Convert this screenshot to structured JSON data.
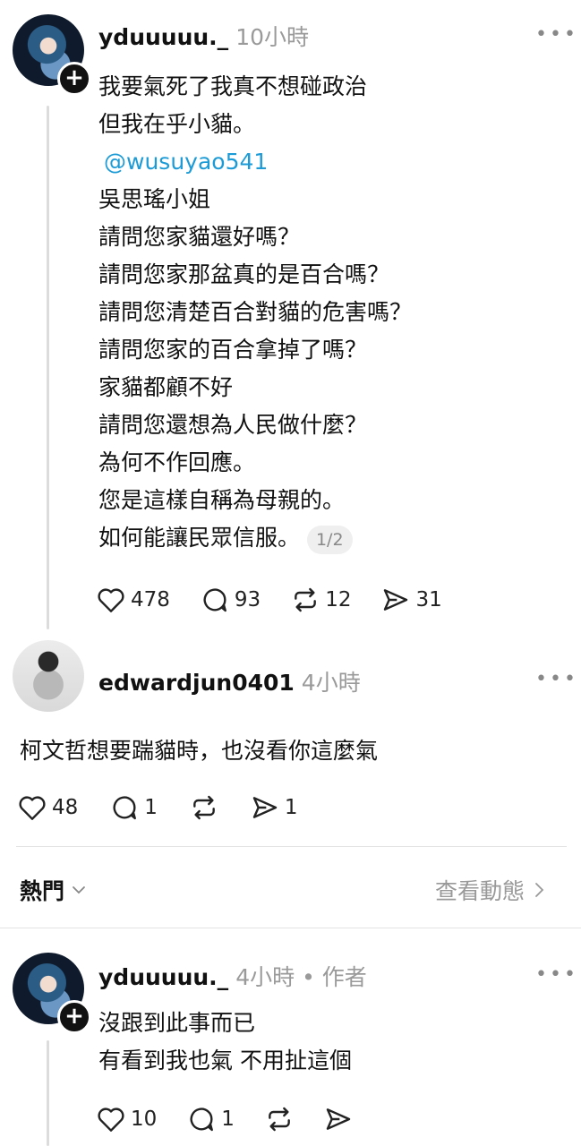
{
  "post": {
    "username": "yduuuuu._",
    "time": "10小時",
    "lines": [
      "我要氣死了我真不想碰政治",
      "但我在乎小貓。",
      "@wusuyao541",
      "吳思瑤小姐",
      "請問您家貓還好嗎？",
      "請問您家那盆真的是百合嗎？",
      "請問您清楚百合對貓的危害嗎？",
      "請問您家的百合拿掉了嗎？",
      "家貓都顧不好",
      "請問您還想為人民做什麼？",
      "為何不作回應。",
      "您是這樣自稱為母親的。",
      "如何能讓民眾信服。"
    ],
    "pager": "1/2",
    "likes": "478",
    "comments": "93",
    "reposts": "12",
    "shares": "31"
  },
  "reply1": {
    "username": "edwardjun0401",
    "time": "4小時",
    "text": "柯文哲想要踹貓時，也沒看你這麼氣",
    "likes": "48",
    "comments": "1",
    "shares": "1"
  },
  "section": {
    "hot_label": "熱門",
    "view_all": "查看動態"
  },
  "reply2": {
    "username": "yduuuuu._",
    "time": "4小時",
    "author_tag": "• 作者",
    "lines": [
      "沒跟到此事而已",
      "有看到我也氣 不用扯這個"
    ],
    "likes": "10",
    "comments": "1"
  },
  "colors": {
    "mention": "#1d9bd6",
    "muted": "#9a9a9a"
  }
}
